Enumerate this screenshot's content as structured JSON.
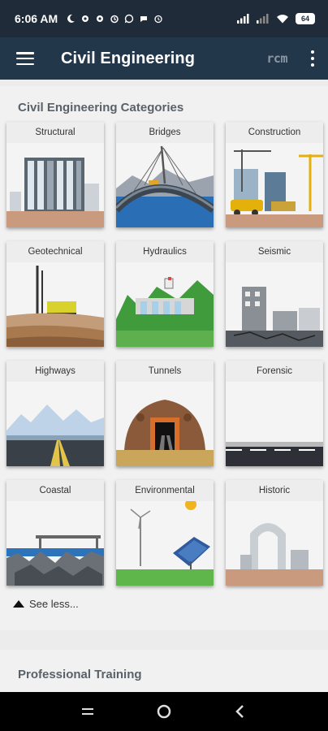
{
  "status_bar": {
    "time": "6:06 AM",
    "battery": "64",
    "icons": [
      "moon-icon",
      "gear-icon",
      "gear-icon",
      "alarm-icon",
      "whatsapp-icon",
      "chat-icon",
      "alarm-clock-icon",
      "signal-icon",
      "signal-icon",
      "wifi-icon",
      "battery-icon"
    ]
  },
  "app_bar": {
    "title": "Civil Engineering",
    "logo_text": "rcm",
    "menu_icon": "hamburger-menu-icon",
    "overflow_icon": "more-vert-icon"
  },
  "categories": {
    "title": "Civil Engineering Categories",
    "items": [
      {
        "label": "Structural"
      },
      {
        "label": "Bridges"
      },
      {
        "label": "Construction"
      },
      {
        "label": "Geotechnical"
      },
      {
        "label": "Hydraulics"
      },
      {
        "label": "Seismic"
      },
      {
        "label": "Highways"
      },
      {
        "label": "Tunnels"
      },
      {
        "label": "Forensic"
      },
      {
        "label": "Coastal"
      },
      {
        "label": "Environmental"
      },
      {
        "label": "Historic"
      }
    ],
    "see_less": "See less..."
  },
  "training": {
    "title": "Professional Training"
  },
  "colors": {
    "status_bar": "#1f2b38",
    "app_bar": "#23374a",
    "background": "#ececec",
    "card": "#f7f7f7"
  }
}
